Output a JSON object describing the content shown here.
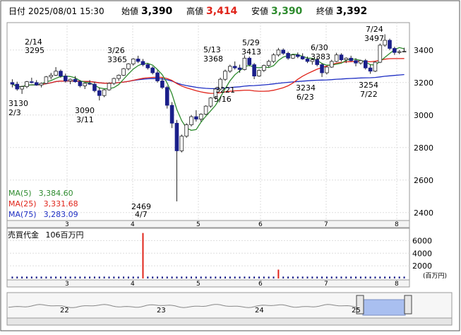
{
  "header": {
    "datetime_label": "日付",
    "datetime": "2025/08/01 15:30",
    "open_label": "始値",
    "open": "3,390",
    "high_label": "高値",
    "high": "3,414",
    "low_label": "安値",
    "low": "3,390",
    "close_label": "終値",
    "close": "3,392"
  },
  "colors": {
    "up": "#ffffff",
    "down": "#1a1f8a",
    "ma5": "#2e8b2e",
    "ma25": "#e0241a",
    "ma75": "#1f2fc4",
    "high_value": "#e0241a",
    "low_value": "#2e8b2e",
    "volume": "#1a1f8a",
    "volume_spike": "#e0241a",
    "navigator_fill": "#a9bff0"
  },
  "legend": [
    {
      "name": "MA(5)",
      "value": "3,384.60",
      "color": "#2e8b2e"
    },
    {
      "name": "MA(25)",
      "value": "3,331.68",
      "color": "#e0241a"
    },
    {
      "name": "MA(75)",
      "value": "3,283.09",
      "color": "#1f2fc4"
    }
  ],
  "volume_label": "売買代金",
  "volume_value": "106百万円",
  "volume_unit": "(百万円)",
  "chart_data": [
    {
      "type": "candlestick",
      "title": "",
      "x_tick_labels": [
        "3",
        "4",
        "5",
        "6",
        "7",
        "8"
      ],
      "y_ticks": [
        2400,
        2600,
        2800,
        3000,
        3200,
        3400
      ],
      "ylim": [
        2360,
        3560
      ],
      "grid": true,
      "annotations": [
        {
          "value": "3130",
          "date": "2/3"
        },
        {
          "value": "3295",
          "date": "2/14"
        },
        {
          "value": "3090",
          "date": "3/11"
        },
        {
          "value": "3365",
          "date": "3/26"
        },
        {
          "value": "2469",
          "date": "4/7"
        },
        {
          "value": "3368",
          "date": "5/13"
        },
        {
          "value": "3221",
          "date": "5/16"
        },
        {
          "value": "3413",
          "date": "5/29"
        },
        {
          "value": "3383",
          "date": "6/30"
        },
        {
          "value": "3234",
          "date": "6/23"
        },
        {
          "value": "3497",
          "date": "7/24"
        },
        {
          "value": "3254",
          "date": "7/22"
        }
      ],
      "candles": [
        [
          3200,
          3220,
          3170,
          3190
        ],
        [
          3190,
          3205,
          3150,
          3160
        ],
        [
          3160,
          3180,
          3130,
          3175
        ],
        [
          3175,
          3210,
          3165,
          3205
        ],
        [
          3205,
          3230,
          3195,
          3200
        ],
        [
          3200,
          3215,
          3180,
          3185
        ],
        [
          3185,
          3200,
          3170,
          3195
        ],
        [
          3195,
          3240,
          3190,
          3235
        ],
        [
          3235,
          3260,
          3220,
          3245
        ],
        [
          3245,
          3295,
          3240,
          3270
        ],
        [
          3270,
          3280,
          3230,
          3240
        ],
        [
          3240,
          3255,
          3200,
          3210
        ],
        [
          3210,
          3225,
          3190,
          3220
        ],
        [
          3220,
          3240,
          3200,
          3205
        ],
        [
          3205,
          3215,
          3170,
          3180
        ],
        [
          3180,
          3200,
          3160,
          3195
        ],
        [
          3195,
          3215,
          3185,
          3190
        ],
        [
          3190,
          3205,
          3140,
          3150
        ],
        [
          3150,
          3170,
          3090,
          3120
        ],
        [
          3120,
          3160,
          3110,
          3155
        ],
        [
          3155,
          3200,
          3150,
          3195
        ],
        [
          3195,
          3230,
          3185,
          3225
        ],
        [
          3225,
          3250,
          3210,
          3245
        ],
        [
          3245,
          3290,
          3240,
          3285
        ],
        [
          3285,
          3320,
          3275,
          3315
        ],
        [
          3315,
          3350,
          3305,
          3345
        ],
        [
          3345,
          3365,
          3320,
          3330
        ],
        [
          3330,
          3345,
          3300,
          3310
        ],
        [
          3310,
          3320,
          3280,
          3290
        ],
        [
          3290,
          3300,
          3250,
          3260
        ],
        [
          3260,
          3275,
          3200,
          3210
        ],
        [
          3210,
          3230,
          3160,
          3170
        ],
        [
          3170,
          3180,
          3040,
          3060
        ],
        [
          3060,
          3080,
          2920,
          2950
        ],
        [
          2950,
          2970,
          2469,
          2780
        ],
        [
          2780,
          2880,
          2770,
          2870
        ],
        [
          2870,
          2950,
          2860,
          2940
        ],
        [
          2940,
          3000,
          2930,
          2990
        ],
        [
          2990,
          3030,
          2960,
          2975
        ],
        [
          2975,
          3010,
          2960,
          3005
        ],
        [
          3005,
          3060,
          3000,
          3055
        ],
        [
          3055,
          3110,
          3045,
          3105
        ],
        [
          3105,
          3170,
          3095,
          3160
        ],
        [
          3160,
          3230,
          3150,
          3220
        ],
        [
          3220,
          3280,
          3210,
          3270
        ],
        [
          3270,
          3310,
          3260,
          3300
        ],
        [
          3300,
          3330,
          3280,
          3290
        ],
        [
          3290,
          3310,
          3260,
          3280
        ],
        [
          3280,
          3368,
          3275,
          3350
        ],
        [
          3350,
          3360,
          3300,
          3310
        ],
        [
          3310,
          3320,
          3221,
          3240
        ],
        [
          3240,
          3280,
          3235,
          3275
        ],
        [
          3275,
          3310,
          3265,
          3305
        ],
        [
          3305,
          3340,
          3295,
          3330
        ],
        [
          3330,
          3380,
          3320,
          3370
        ],
        [
          3370,
          3413,
          3360,
          3400
        ],
        [
          3400,
          3410,
          3370,
          3380
        ],
        [
          3380,
          3390,
          3340,
          3350
        ],
        [
          3350,
          3375,
          3345,
          3370
        ],
        [
          3370,
          3385,
          3350,
          3360
        ],
        [
          3360,
          3380,
          3340,
          3345
        ],
        [
          3345,
          3360,
          3320,
          3330
        ],
        [
          3330,
          3350,
          3310,
          3340
        ],
        [
          3340,
          3360,
          3300,
          3310
        ],
        [
          3310,
          3320,
          3234,
          3260
        ],
        [
          3260,
          3300,
          3250,
          3295
        ],
        [
          3295,
          3340,
          3290,
          3330
        ],
        [
          3330,
          3383,
          3325,
          3370
        ],
        [
          3370,
          3380,
          3330,
          3340
        ],
        [
          3340,
          3355,
          3320,
          3350
        ],
        [
          3350,
          3365,
          3330,
          3335
        ],
        [
          3335,
          3350,
          3300,
          3320
        ],
        [
          3320,
          3340,
          3310,
          3335
        ],
        [
          3335,
          3345,
          3280,
          3290
        ],
        [
          3290,
          3310,
          3254,
          3270
        ],
        [
          3270,
          3330,
          3265,
          3325
        ],
        [
          3325,
          3440,
          3320,
          3430
        ],
        [
          3430,
          3497,
          3420,
          3460
        ],
        [
          3460,
          3470,
          3400,
          3410
        ],
        [
          3410,
          3420,
          3370,
          3385
        ],
        [
          3385,
          3400,
          3375,
          3390
        ],
        [
          3390,
          3414,
          3390,
          3392
        ]
      ],
      "ma5_label": "MA(5)",
      "ma25_label": "MA(25)",
      "ma75_label": "MA(75)"
    },
    {
      "type": "bar",
      "title": "",
      "y_ticks": [
        2000,
        4000,
        6000
      ],
      "ylim": [
        0,
        7500
      ],
      "x_tick_labels": [
        "3",
        "4",
        "5",
        "6",
        "7",
        "8"
      ],
      "spike_index": 27,
      "spike_value": 7200,
      "secondary_spike_index": 55,
      "secondary_spike_value": 1400,
      "base_value": 300
    }
  ],
  "navigator": {
    "labels": [
      "22",
      "23",
      "24",
      "25"
    ]
  }
}
